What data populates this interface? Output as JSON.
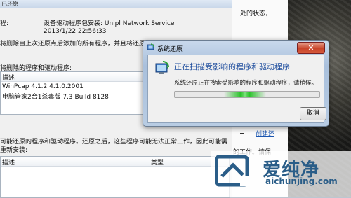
{
  "background_window": {
    "title": "已还原",
    "rows": [
      {
        "label": "程:",
        "value": "设备驱动程序包安装: Unipl Network Service"
      },
      {
        "label": ":",
        "value": "2013/1/22 22:56:33"
      },
      {
        "label": "将删除自上次还原点后添加的所有程序，并且将还原已删",
        "value": ""
      }
    ],
    "deleted_section_label": "将删除的程序和驱动程序:",
    "deleted_list_header": "描述",
    "deleted_items": [
      "WinPcap 4.1.2 4.1.0.2001",
      "电脑管家2合1杀毒版 7.3 Build 8128"
    ],
    "restored_section_text_1": "可能还原的程序和驱动程序。还原之后，这些程序可能无法正常工作，因此可能需",
    "restored_section_text_2": "重新安装:",
    "restored_list_headers": [
      "描述",
      "类型"
    ]
  },
  "right_doc": {
    "line1": "处的状态，",
    "link1": "创建还",
    "line2": "的工作。请保"
  },
  "dialog": {
    "title": "系统还原",
    "heading": "正在扫描受影响的程序和驱动程序",
    "subtext": "系统还原正在搜索受影响的程序和驱动程序，请稍候。",
    "progress": 0.5,
    "cancel_label": "取消"
  },
  "watermark": {
    "brand_cn": "爱纯净",
    "brand_en": "aichunjing.com"
  }
}
